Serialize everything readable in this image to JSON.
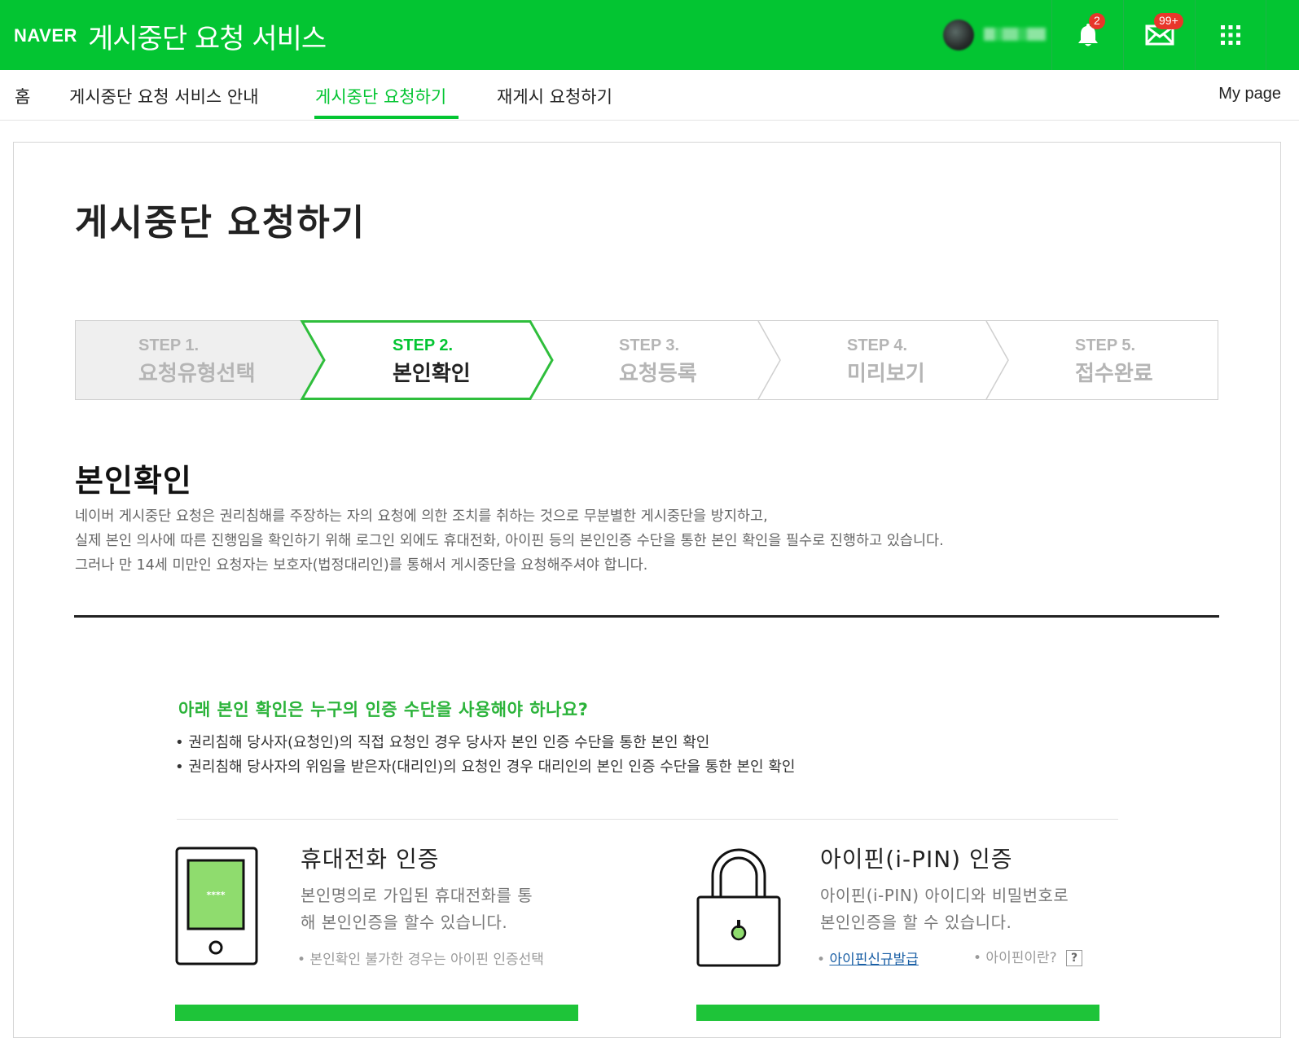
{
  "header": {
    "logo": "NAVER",
    "service_title": "게시중단 요청 서비스",
    "notification_count": "2",
    "mail_count": "99+"
  },
  "nav": {
    "items": [
      {
        "label": "홈"
      },
      {
        "label": "게시중단 요청 서비스 안내"
      },
      {
        "label": "게시중단 요청하기",
        "active": true
      },
      {
        "label": "재게시 요청하기"
      }
    ],
    "mypage": "My page"
  },
  "page": {
    "title": "게시중단 요청하기"
  },
  "steps": [
    {
      "num": "STEP 1.",
      "name": "요청유형선택",
      "state": "done"
    },
    {
      "num": "STEP 2.",
      "name": "본인확인",
      "state": "active"
    },
    {
      "num": "STEP 3.",
      "name": "요청등록",
      "state": "todo"
    },
    {
      "num": "STEP 4.",
      "name": "미리보기",
      "state": "todo"
    },
    {
      "num": "STEP 5.",
      "name": "접수완료",
      "state": "todo"
    }
  ],
  "section": {
    "title": "본인확인",
    "desc": [
      "네이버 게시중단 요청은 권리침해를 주장하는 자의 요청에 의한 조치를 취하는 것으로 무분별한 게시중단을 방지하고,",
      "실제 본인 의사에 따른 진행임을 확인하기 위해 로그인 외에도 휴대전화, 아이핀 등의 본인인증 수단을 통한 본인 확인을 필수로 진행하고 있습니다.",
      "그러나 만 14세 미만인 요청자는 보호자(법정대리인)를 통해서 게시중단을 요청해주셔야 합니다."
    ]
  },
  "question": {
    "title": "아래 본인 확인은 누구의 인증 수단을 사용해야 하나요?",
    "items": [
      "• 권리침해 당사자(요청인)의 직접 요청인 경우 당사자 본인 인증 수단을 통한 본인 확인",
      "• 권리침해 당사자의 위임을 받은자(대리인)의 요청인 경우 대리인의 본인 인증 수단을 통한 본인 확인"
    ]
  },
  "auth": {
    "phone": {
      "title": "휴대전화 인증",
      "desc_line1": "본인명의로 가입된 휴대전화를 통",
      "desc_line2": "해 본인인증을 할수 있습니다.",
      "note": "• 본인확인 불가한 경우는 아이핀 인증선택",
      "screen_text": "****"
    },
    "ipin": {
      "title": "아이핀(i-PIN) 인증",
      "desc_line1": "아이핀(i-PIN) 아이디와 비밀번호로",
      "desc_line2": "본인인증을 할 수 있습니다.",
      "link_bullet": "•",
      "link_label": "아이핀신규발급",
      "help_label": "• 아이핀이란?",
      "help_icon": "?"
    }
  },
  "colors": {
    "brand_green": "#03c532",
    "badge_red": "#e8362a",
    "step_inactive": "#b5b5b5"
  }
}
